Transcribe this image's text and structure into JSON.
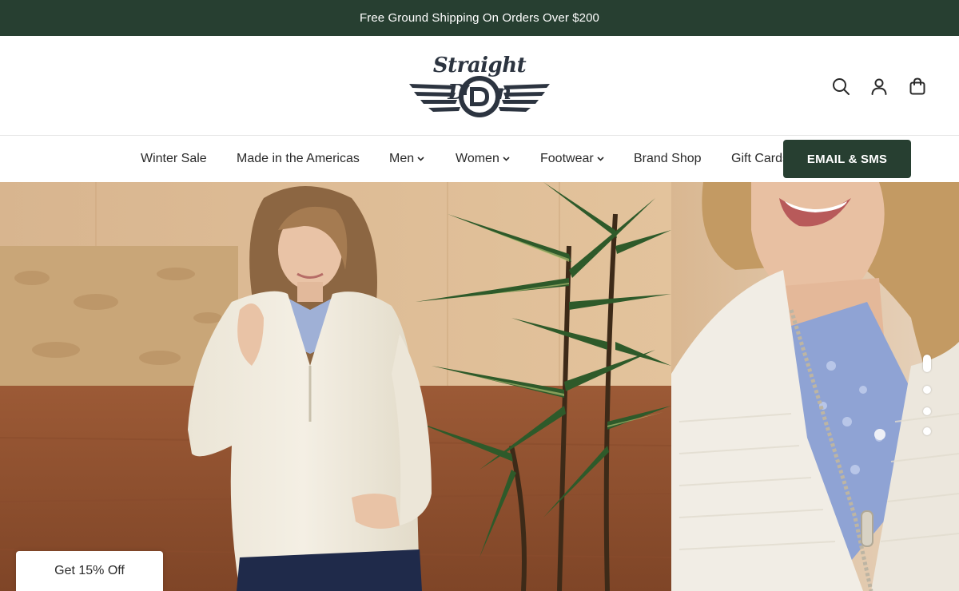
{
  "announcement": "Free Ground Shipping On Orders Over $200",
  "logo": {
    "text": "Straight Down"
  },
  "header_icons": [
    {
      "name": "search-icon"
    },
    {
      "name": "account-icon"
    },
    {
      "name": "cart-icon"
    }
  ],
  "nav": {
    "items": [
      {
        "label": "Winter Sale",
        "dropdown": false
      },
      {
        "label": "Made in the Americas",
        "dropdown": false
      },
      {
        "label": "Men",
        "dropdown": true
      },
      {
        "label": "Women",
        "dropdown": true
      },
      {
        "label": "Footwear",
        "dropdown": true
      },
      {
        "label": "Brand Shop",
        "dropdown": false
      },
      {
        "label": "Gift Cards",
        "dropdown": false
      }
    ],
    "cta_label": "EMAIL & SMS"
  },
  "hero": {
    "slide_count": 4,
    "active_slide": 1
  },
  "promo_tab": "Get 15% Off",
  "colors": {
    "brand_green": "#273f31",
    "logo_navy": "#2c3440",
    "text": "#2a2a2a"
  }
}
